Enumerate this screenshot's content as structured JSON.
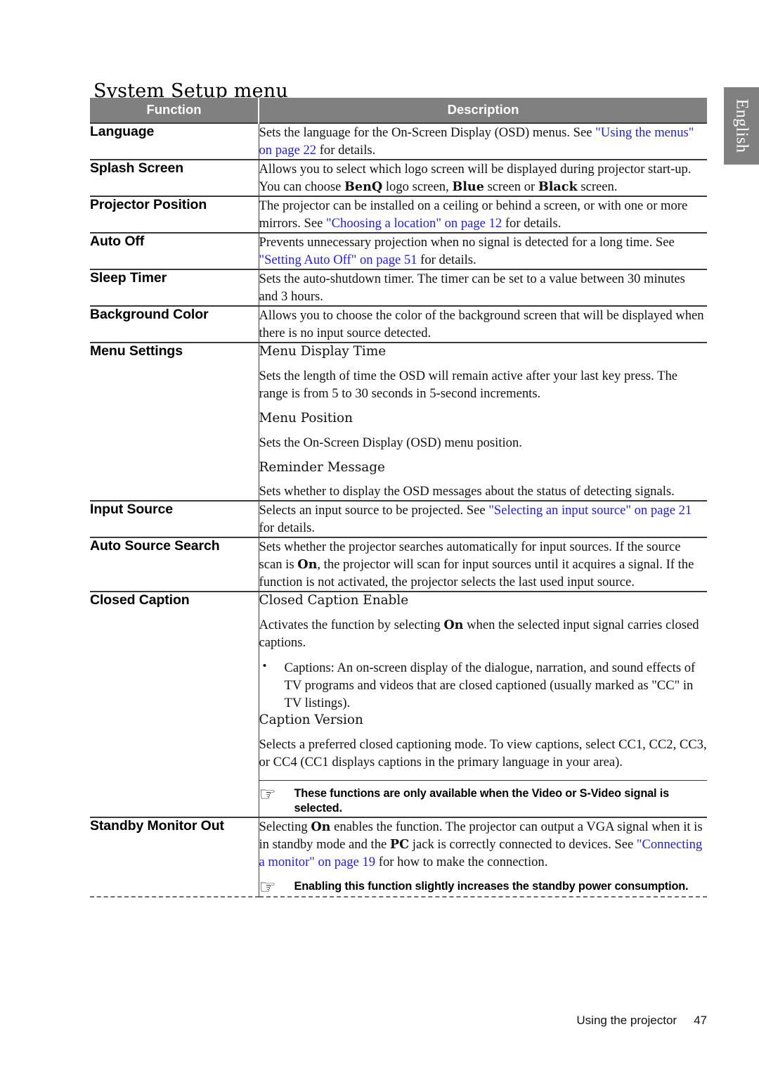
{
  "page": {
    "title": "System Setup menu",
    "language_tab": "English",
    "footer_label": "Using the projector",
    "footer_page_number": "47"
  },
  "colors": {
    "header_background": "#808080",
    "header_text": "#ffffff",
    "link": "#2222cc",
    "rule": "#3a3a3a"
  },
  "icons": {
    "note_pointing_hand": "☞"
  },
  "table": {
    "columns": [
      "Function",
      "Description"
    ],
    "rows": [
      {
        "function": "Language",
        "blocks": [
          {
            "type": "paragraph",
            "runs": [
              {
                "text": "Sets the language for the On-Screen Display (OSD) menus. See ",
                "style": "normal"
              },
              {
                "text": "\"Using the menus\" on page 22",
                "style": "link"
              },
              {
                "text": " for details.",
                "style": "normal"
              }
            ]
          }
        ]
      },
      {
        "function": "Splash Screen",
        "blocks": [
          {
            "type": "paragraph",
            "runs": [
              {
                "text": "Allows you to select which logo screen will be displayed during projector start-up. You can choose ",
                "style": "normal"
              },
              {
                "text": "BenQ",
                "style": "bold"
              },
              {
                "text": " logo screen, ",
                "style": "normal"
              },
              {
                "text": "Blue",
                "style": "bold"
              },
              {
                "text": " screen or ",
                "style": "normal"
              },
              {
                "text": "Black",
                "style": "bold"
              },
              {
                "text": " screen.",
                "style": "normal"
              }
            ]
          }
        ]
      },
      {
        "function": "Projector Position",
        "blocks": [
          {
            "type": "paragraph",
            "runs": [
              {
                "text": "The projector can be installed on a ceiling or behind a screen, or with one or more mirrors. See ",
                "style": "normal"
              },
              {
                "text": "\"Choosing a location\" on page 12",
                "style": "link"
              },
              {
                "text": " for details.",
                "style": "normal"
              }
            ]
          }
        ]
      },
      {
        "function": "Auto Off",
        "blocks": [
          {
            "type": "paragraph",
            "runs": [
              {
                "text": "Prevents unnecessary projection when no signal is detected for a long time. See ",
                "style": "normal"
              },
              {
                "text": "\"Setting Auto Off\" on page 51",
                "style": "link"
              },
              {
                "text": " for details.",
                "style": "normal"
              }
            ]
          }
        ]
      },
      {
        "function": "Sleep Timer",
        "blocks": [
          {
            "type": "paragraph",
            "runs": [
              {
                "text": "Sets the auto-shutdown timer. The timer can be set to a value between 30 minutes and 3 hours.",
                "style": "normal"
              }
            ]
          }
        ]
      },
      {
        "function": "Background Color",
        "blocks": [
          {
            "type": "paragraph",
            "runs": [
              {
                "text": "Allows you to choose the color of the background screen that will be displayed when there is no input source detected.",
                "style": "normal"
              }
            ]
          }
        ]
      },
      {
        "function": "Menu Settings",
        "blocks": [
          {
            "type": "subheading",
            "runs": [
              {
                "text": "Menu Display Time",
                "style": "normal"
              }
            ]
          },
          {
            "type": "paragraph",
            "runs": [
              {
                "text": "Sets the length of time the OSD will remain active after your last key press. The range is from 5 to 30 seconds in 5-second increments.",
                "style": "normal"
              }
            ]
          },
          {
            "type": "subheading",
            "runs": [
              {
                "text": "Menu Position",
                "style": "normal"
              }
            ]
          },
          {
            "type": "paragraph",
            "runs": [
              {
                "text": "Sets the On-Screen Display (OSD) menu position.",
                "style": "normal"
              }
            ]
          },
          {
            "type": "subheading",
            "runs": [
              {
                "text": "Reminder Message",
                "style": "normal"
              }
            ]
          },
          {
            "type": "paragraph",
            "runs": [
              {
                "text": "Sets whether to display the OSD messages about the status of detecting signals.",
                "style": "normal"
              }
            ]
          }
        ]
      },
      {
        "function": "Input Source",
        "blocks": [
          {
            "type": "paragraph",
            "runs": [
              {
                "text": "Selects an input source to be projected. See ",
                "style": "normal"
              },
              {
                "text": "\"Selecting an input source\" on page 21",
                "style": "link"
              },
              {
                "text": " for details.",
                "style": "normal"
              }
            ]
          }
        ]
      },
      {
        "function": "Auto Source Search",
        "blocks": [
          {
            "type": "paragraph",
            "runs": [
              {
                "text": "Sets whether the projector searches automatically for input sources. If the source scan is ",
                "style": "normal"
              },
              {
                "text": "On",
                "style": "bold"
              },
              {
                "text": ", the projector will scan for input sources until it acquires a signal. If the function is not activated, the projector selects the last used input source.",
                "style": "normal"
              }
            ]
          }
        ]
      },
      {
        "function": "Closed Caption",
        "blocks": [
          {
            "type": "subheading",
            "runs": [
              {
                "text": "Closed Caption Enable",
                "style": "normal"
              }
            ]
          },
          {
            "type": "paragraph",
            "runs": [
              {
                "text": "Activates the function by selecting ",
                "style": "normal"
              },
              {
                "text": "On",
                "style": "bold"
              },
              {
                "text": " when the selected input signal carries closed captions.",
                "style": "normal"
              }
            ]
          },
          {
            "type": "bullets",
            "items": [
              "Captions: An on-screen display of the dialogue, narration, and sound effects of TV programs and videos that are closed captioned (usually marked as \"CC\" in TV listings)."
            ]
          },
          {
            "type": "subheading",
            "runs": [
              {
                "text": "Caption Version",
                "style": "normal"
              }
            ]
          },
          {
            "type": "paragraph",
            "runs": [
              {
                "text": "Selects a preferred closed captioning mode. To view captions, select CC1, CC2, CC3, or CC4 (CC1 displays captions in the primary language in your area).",
                "style": "normal"
              }
            ]
          },
          {
            "type": "note",
            "rule": true,
            "text": "These functions are only available when the Video or S-Video signal is selected."
          }
        ]
      },
      {
        "function": "Standby Monitor Out",
        "blocks": [
          {
            "type": "paragraph",
            "runs": [
              {
                "text": "Selecting ",
                "style": "normal"
              },
              {
                "text": "On",
                "style": "bold"
              },
              {
                "text": " enables the function. The projector can output a VGA signal when it is in standby mode and the ",
                "style": "normal"
              },
              {
                "text": "PC",
                "style": "bold"
              },
              {
                "text": " jack is correctly connected to devices. See ",
                "style": "normal"
              },
              {
                "text": "\"Connecting a monitor\" on page 19",
                "style": "link"
              },
              {
                "text": " for how to make the connection.",
                "style": "normal"
              }
            ]
          },
          {
            "type": "note",
            "rule": false,
            "text": "Enabling this function slightly increases the standby power consumption."
          }
        ]
      }
    ]
  }
}
